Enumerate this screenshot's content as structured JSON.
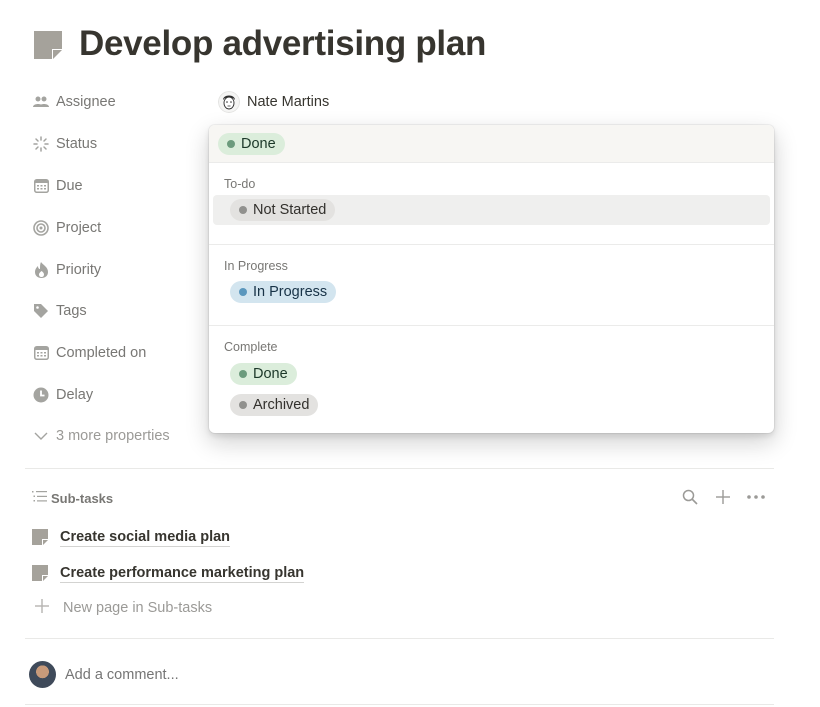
{
  "page": {
    "icon": "document-icon",
    "title": "Develop advertising plan"
  },
  "properties": [
    {
      "icon": "people-icon",
      "label": "Assignee"
    },
    {
      "icon": "status-spinner-icon",
      "label": "Status"
    },
    {
      "icon": "calendar-icon",
      "label": "Due"
    },
    {
      "icon": "target-icon",
      "label": "Project"
    },
    {
      "icon": "fire-icon",
      "label": "Priority"
    },
    {
      "icon": "tag-icon",
      "label": "Tags"
    },
    {
      "icon": "calendar-icon",
      "label": "Completed on"
    },
    {
      "icon": "clock-icon",
      "label": "Delay"
    }
  ],
  "assignee": {
    "name": "Nate Martins",
    "avatar": "avatar-illustration"
  },
  "more_properties": {
    "icon": "chevron-down-icon",
    "label": "3 more properties"
  },
  "status_dropdown": {
    "selected": {
      "label": "Done",
      "bg": "#dbeddb",
      "dot": "#6c9b7d",
      "text": "#1c3829"
    },
    "groups": [
      {
        "label": "To-do",
        "options": [
          {
            "label": "Not Started",
            "bg": "#e3e2e0",
            "dot": "#91918e",
            "text": "#32302c",
            "hovered": true
          }
        ]
      },
      {
        "label": "In Progress",
        "options": [
          {
            "label": "In Progress",
            "bg": "#d3e5ef",
            "dot": "#5b97bd",
            "text": "#183347",
            "hovered": false
          }
        ]
      },
      {
        "label": "Complete",
        "options": [
          {
            "label": "Done",
            "bg": "#dbeddb",
            "dot": "#6c9b7d",
            "text": "#1c3829",
            "hovered": false
          },
          {
            "label": "Archived",
            "bg": "#e3e2e0",
            "dot": "#91918e",
            "text": "#32302c",
            "hovered": false
          }
        ]
      }
    ]
  },
  "subtasks": {
    "title": "Sub-tasks",
    "icon": "list-icon",
    "actions": [
      {
        "icon": "search-icon"
      },
      {
        "icon": "plus-icon"
      },
      {
        "icon": "more-horizontal-icon"
      }
    ],
    "items": [
      {
        "label": "Create social media plan"
      },
      {
        "label": "Create performance marketing plan"
      }
    ],
    "new_page_label": "New page in Sub-tasks"
  },
  "comment": {
    "placeholder": "Add a comment..."
  }
}
